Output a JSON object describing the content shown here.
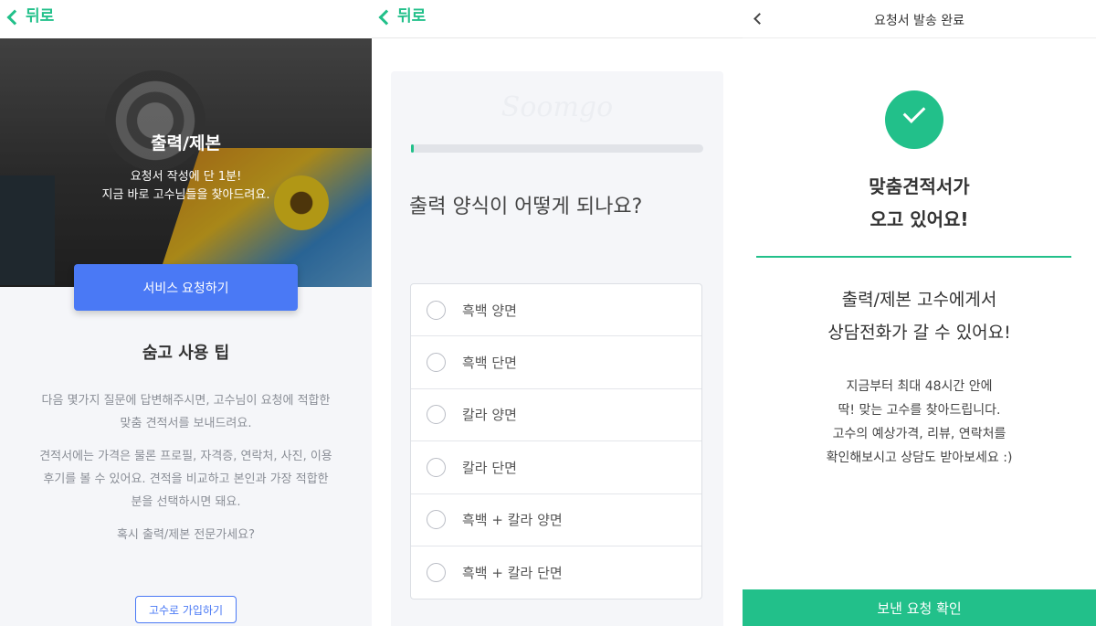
{
  "panel1": {
    "back_label": "뒤로",
    "hero_title": "출력/제본",
    "hero_line1": "요청서 작성에 단 1분!",
    "hero_line2": "지금 바로 고수님들을 찾아드려요.",
    "request_button": "서비스 요청하기",
    "tips_title": "숨고 사용 팁",
    "tips_p1_line1": "다음 몇가지 질문에 답변해주시면, 고수님이 요청에 적합한",
    "tips_p1_line2": "맞춤 견적서를 보내드려요.",
    "tips_p2_line1": "견적서에는 가격은 물론 프로필, 자격증, 연락처, 사진, 이용",
    "tips_p2_line2": "후기를 볼 수 있어요. 견적을 비교하고 본인과 가장 적합한",
    "tips_p2_line3": "분을 선택하시면 돼요.",
    "tips_p3": "혹시 출력/제본 전문가세요?",
    "join_button": "고수로 가입하기",
    "colors": {
      "accent_green": "#22c08a",
      "button_blue": "#4a79f5"
    }
  },
  "panel2": {
    "back_label": "뒤로",
    "watermark": "Soomgo",
    "progress_fraction": 0.01,
    "question": "출력 양식이 어떻게 되나요?",
    "options": [
      {
        "label": "흑백 양면"
      },
      {
        "label": "흑백 단면"
      },
      {
        "label": "칼라 양면"
      },
      {
        "label": "칼라 단면"
      },
      {
        "label": "흑백 + 칼라 양면"
      },
      {
        "label": "흑백 + 칼라 단면"
      }
    ]
  },
  "panel3": {
    "header_title": "요청서 발송 완료",
    "check_icon": "check-icon",
    "title_line1": "맞춤견적서가",
    "title_line2": "오고 있어요!",
    "sub_line1": "출력/제본 고수에게서",
    "sub_line2": "상담전화가 갈 수 있어요!",
    "desc_line1": "지금부터 최대 48시간 안에",
    "desc_line2": "딱! 맞는 고수를 찾아드립니다.",
    "desc_line3": "고수의 예상가격, 리뷰, 연락처를",
    "desc_line4": "확인해보시고 상담도 받아보세요 :)",
    "confirm_button": "보낸 요청 확인"
  }
}
